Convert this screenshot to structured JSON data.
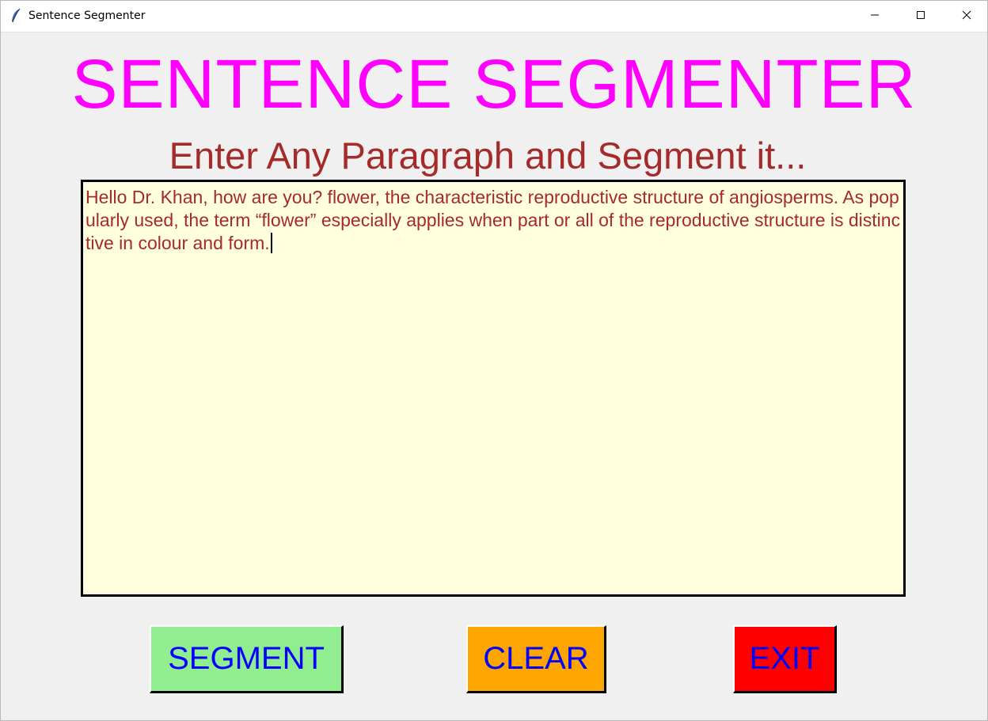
{
  "window": {
    "title": "Sentence Segmenter",
    "controls": {
      "minimize_icon": "minimize-icon",
      "maximize_icon": "maximize-icon",
      "close_icon": "close-icon"
    }
  },
  "app": {
    "heading": "SENTENCE SEGMENTER",
    "subheading": "Enter Any Paragraph and Segment it...",
    "input_text": "Hello Dr. Khan, how are you? flower, the characteristic reproductive structure of angiosperms. As popularly used, the term “flower” especially applies when part or all of the reproductive structure is distinctive in colour and form."
  },
  "buttons": {
    "segment": "SEGMENT",
    "clear": "CLEAR",
    "exit": "EXIT"
  },
  "colors": {
    "heading": "#ff00ff",
    "subheading": "#a52a2a",
    "text_area_bg": "#ffffe0",
    "text_color": "#a52a2a",
    "button_text": "#0000ff",
    "segment_bg": "#90ee90",
    "clear_bg": "#ffa500",
    "exit_bg": "#ff0000"
  }
}
